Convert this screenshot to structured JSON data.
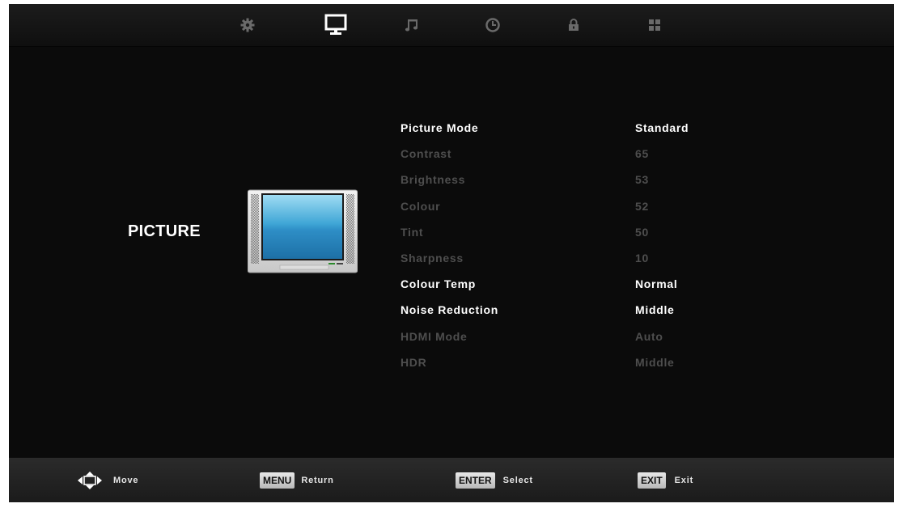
{
  "tabs": [
    {
      "name": "settings",
      "icon": "gear-icon",
      "active": false
    },
    {
      "name": "picture",
      "icon": "monitor-icon",
      "active": true
    },
    {
      "name": "sound",
      "icon": "music-note-icon",
      "active": false
    },
    {
      "name": "time",
      "icon": "clock-icon",
      "active": false
    },
    {
      "name": "lock",
      "icon": "lock-icon",
      "active": false
    },
    {
      "name": "apps",
      "icon": "grid-icon",
      "active": false
    }
  ],
  "section": {
    "title": "PICTURE",
    "icon": "tv-icon"
  },
  "menu": {
    "items": [
      {
        "label": "Picture Mode",
        "value": "Standard",
        "enabled": true
      },
      {
        "label": "Contrast",
        "value": "65",
        "enabled": false
      },
      {
        "label": "Brightness",
        "value": "53",
        "enabled": false
      },
      {
        "label": "Colour",
        "value": "52",
        "enabled": false
      },
      {
        "label": "Tint",
        "value": "50",
        "enabled": false
      },
      {
        "label": "Sharpness",
        "value": "10",
        "enabled": false
      },
      {
        "label": "Colour Temp",
        "value": "Normal",
        "enabled": true
      },
      {
        "label": "Noise Reduction",
        "value": "Middle",
        "enabled": true
      },
      {
        "label": "HDMI Mode",
        "value": "Auto",
        "enabled": false
      },
      {
        "label": "HDR",
        "value": "Middle",
        "enabled": false
      }
    ]
  },
  "footer": {
    "move": {
      "icon": "dpad-arrows-icon",
      "label": "Move"
    },
    "menu": {
      "key": "MENU",
      "label": "Return"
    },
    "enter": {
      "key": "ENTER",
      "label": "Select"
    },
    "exit": {
      "key": "EXIT",
      "label": "Exit"
    }
  },
  "colors": {
    "enabled_text": "#ffffff",
    "disabled_text": "#4e4e4e",
    "background": "#0c0c0c",
    "active_icon": "#ffffff",
    "inactive_icon": "#6a6a6a"
  }
}
